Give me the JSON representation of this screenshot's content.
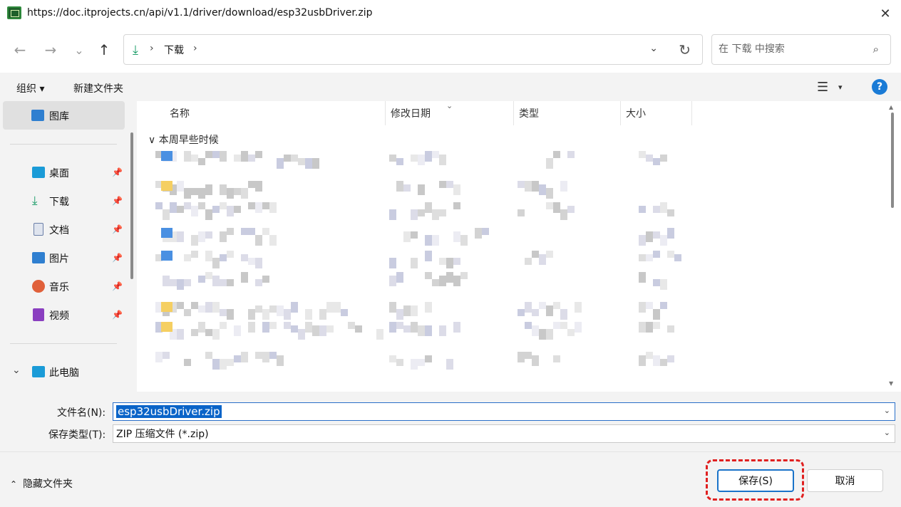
{
  "window": {
    "title": "https://doc.itprojects.cn/api/v1.1/driver/download/esp32usbDriver.zip",
    "close_glyph": "✕"
  },
  "nav": {
    "back_glyph": "←",
    "forward_glyph": "→",
    "recent_glyph": "⌄",
    "up_glyph": "↑",
    "address_sep": "›",
    "address_location": "下载",
    "address_trailing_sep": "›",
    "address_drop_glyph": "⌄",
    "refresh_glyph": "↻",
    "search_placeholder": "在 下载 中搜索",
    "search_glyph": "⌕"
  },
  "commands": {
    "organize": "组织 ▾",
    "new_folder": "新建文件夹",
    "view_glyph": "☰",
    "view_drop_glyph": "▾",
    "help_glyph": "?"
  },
  "sidebar": {
    "gallery": "图库",
    "items": [
      {
        "label": "桌面",
        "icon": "desktop-icon",
        "color": "#1a9bd7"
      },
      {
        "label": "下载",
        "icon": "download-icon",
        "color": "#1e9e6a"
      },
      {
        "label": "文档",
        "icon": "document-icon",
        "color": "#6b7fa8"
      },
      {
        "label": "图片",
        "icon": "picture-icon",
        "color": "#2f7fd0"
      },
      {
        "label": "音乐",
        "icon": "music-icon",
        "color": "#e0603a"
      },
      {
        "label": "视频",
        "icon": "video-icon",
        "color": "#8a3fc0"
      }
    ],
    "pin_glyph": "📌",
    "this_pc": "此电脑",
    "this_pc_chevron": "⌄"
  },
  "columns": {
    "name": "名称",
    "modified": "修改日期",
    "type": "类型",
    "size": "大小",
    "sort_glyph": "⌄"
  },
  "group": {
    "header": "∨ 本周早些时候"
  },
  "form": {
    "filename_label": "文件名(N):",
    "filename_value": "esp32usbDriver.zip",
    "filetype_label": "保存类型(T):",
    "filetype_value": "ZIP 压缩文件 (*.zip)",
    "drop_glyph": "⌄"
  },
  "footer": {
    "hide_folders": "隐藏文件夹",
    "hide_chevron": "⌃",
    "save": "保存(S)",
    "cancel": "取消"
  },
  "colors": {
    "accent": "#1a73c9",
    "highlight": "#e02020"
  }
}
